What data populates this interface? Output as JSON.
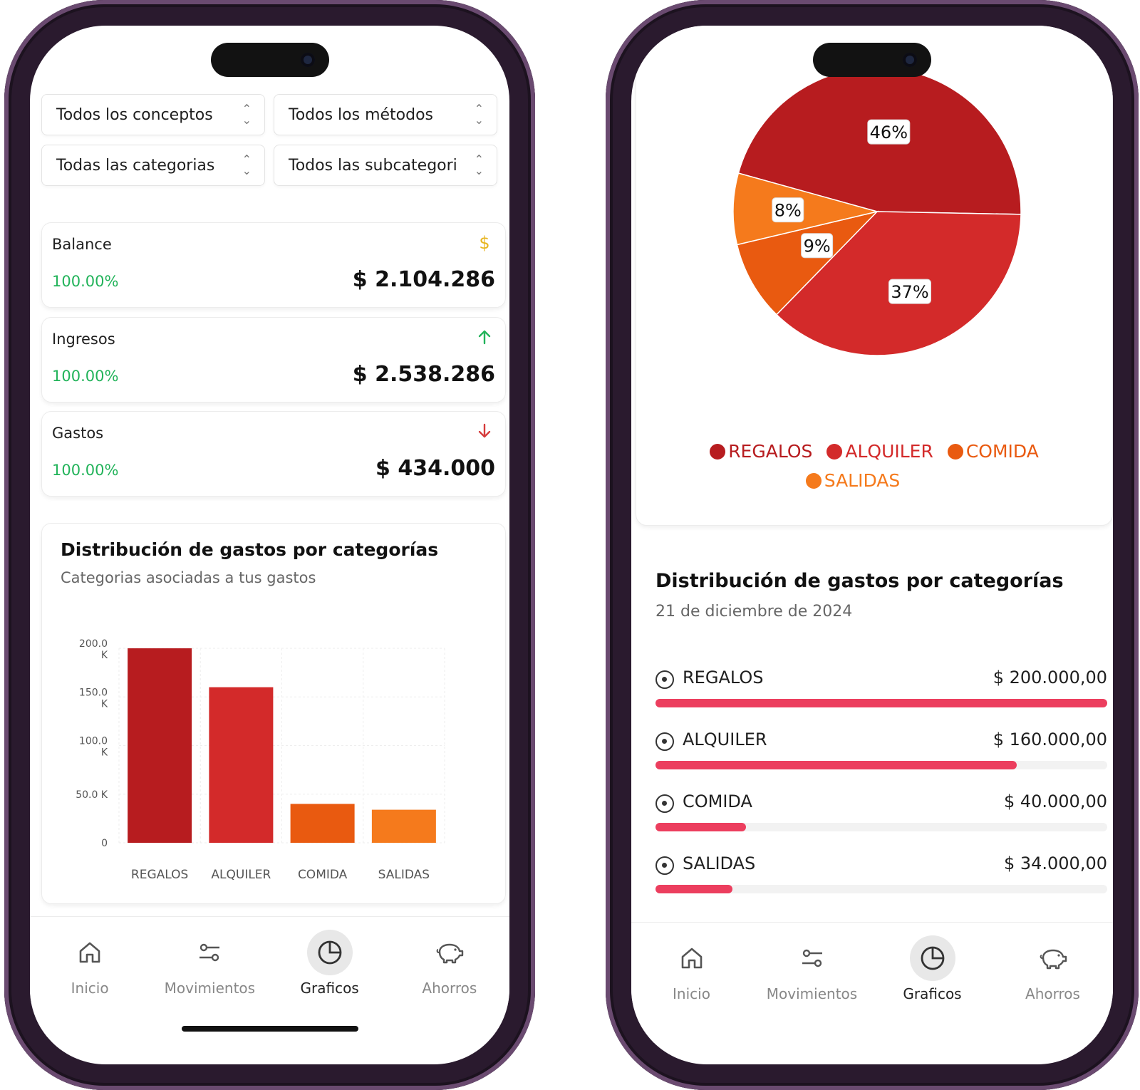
{
  "colors": {
    "regalos": "#b71c1f",
    "alquiler": "#d32a2a",
    "comida": "#e95a10",
    "salidas": "#f57a1c",
    "positive": "#22b35a",
    "negative": "#d63b3b",
    "balance_icon": "#e7b41e",
    "progress": "#ec3e5e"
  },
  "left": {
    "filters": [
      {
        "label": "Todos los conceptos"
      },
      {
        "label": "Todos los métodos"
      },
      {
        "label": "Todas las categorias"
      },
      {
        "label": "Todos las subcategori"
      }
    ],
    "stats": [
      {
        "label": "Balance",
        "percent": "100.00%",
        "amount": "$ 2.104.286",
        "icon": "dollar-icon"
      },
      {
        "label": "Ingresos",
        "percent": "100.00%",
        "amount": "$ 2.538.286",
        "icon": "arrow-up-icon"
      },
      {
        "label": "Gastos",
        "percent": "100.00%",
        "amount": "$ 434.000",
        "icon": "arrow-down-icon"
      }
    ],
    "chart_card": {
      "title": "Distribución de gastos por categorías",
      "subtitle": "Categorias asociadas a tus gastos"
    }
  },
  "chart_data": [
    {
      "type": "bar",
      "categories": [
        "REGALOS",
        "ALQUILER",
        "COMIDA",
        "SALIDAS"
      ],
      "values": [
        200000,
        160000,
        40000,
        34000
      ],
      "ylim": [
        0,
        200000
      ],
      "yticks": [
        {
          "value": 0,
          "line1": "0",
          "line2": ""
        },
        {
          "value": 50000,
          "line1": "50.0 K",
          "line2": ""
        },
        {
          "value": 100000,
          "line1": "100.0",
          "line2": "K"
        },
        {
          "value": 150000,
          "line1": "150.0",
          "line2": "K"
        },
        {
          "value": 200000,
          "line1": "200.0",
          "line2": "K"
        }
      ],
      "grid": true
    },
    {
      "type": "pie",
      "categories": [
        "REGALOS",
        "ALQUILER",
        "COMIDA",
        "SALIDAS"
      ],
      "values": [
        46,
        37,
        9,
        8
      ],
      "labels": [
        "46%",
        "37%",
        "9%",
        "8%"
      ],
      "legend_position": "bottom"
    }
  ],
  "right": {
    "legend": [
      "REGALOS",
      "ALQUILER",
      "COMIDA",
      "SALIDAS"
    ],
    "dist_card": {
      "title": "Distribución de gastos por categorías",
      "date": "21 de diciembre de 2024",
      "rows": [
        {
          "name": "REGALOS",
          "value": "$ 200.000,00",
          "progress": 1.0
        },
        {
          "name": "ALQUILER",
          "value": "$ 160.000,00",
          "progress": 0.8
        },
        {
          "name": "COMIDA",
          "value": "$ 40.000,00",
          "progress": 0.2
        },
        {
          "name": "SALIDAS",
          "value": "$ 34.000,00",
          "progress": 0.17
        }
      ]
    }
  },
  "nav": {
    "items": [
      {
        "label": "Inicio",
        "icon": "home-icon"
      },
      {
        "label": "Movimientos",
        "icon": "sliders-icon"
      },
      {
        "label": "Graficos",
        "icon": "pie-chart-icon",
        "active": true
      },
      {
        "label": "Ahorros",
        "icon": "piggy-bank-icon"
      }
    ]
  }
}
